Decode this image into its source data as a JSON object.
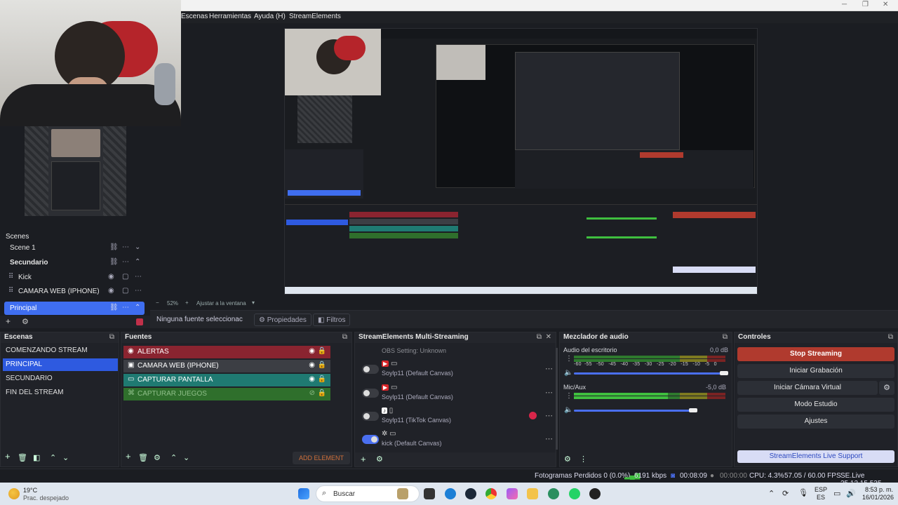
{
  "menu": [
    "Escenas",
    "Herramientas",
    "Ayuda (H)",
    "StreamElements"
  ],
  "left_scenes": {
    "header": "Scenes",
    "items": [
      {
        "label": "Scene 1"
      },
      {
        "label": "Secundario"
      },
      {
        "label": "Kick"
      },
      {
        "label": "CAMARA WEB (IPHONE)"
      },
      {
        "label": "Principal"
      }
    ]
  },
  "preview_bar": {
    "zoom": "52%",
    "fit": "Ajustar a la ventana"
  },
  "properties_bar": {
    "no_source": "Ninguna fuente seleccionac",
    "properties": "Propiedades",
    "filters": "Filtros"
  },
  "scenes_dock": {
    "title": "Escenas",
    "items": [
      "COMENZANDO STREAM",
      "PRINCIPAL",
      "SECUNDARIO",
      "FIN DEL STREAM"
    ],
    "selected": "PRINCIPAL"
  },
  "sources_dock": {
    "title": "Fuentes",
    "items": [
      {
        "label": "ALERTAS",
        "color": "#8a2430"
      },
      {
        "label": "CAMARA WEB (IPHONE)",
        "color": "#3c3e44"
      },
      {
        "label": "CAPTURAR PANTALLA",
        "color": "#1f7a72"
      },
      {
        "label": "CAPTURAR JUEGOS",
        "color": "#2f6f2c"
      }
    ],
    "add_element": "ADD ELEMENT"
  },
  "multistream_dock": {
    "title": "StreamElements Multi-Streaming",
    "obs_setting": "OBS Setting: Unknown",
    "rows": [
      {
        "label": "Soylp11 (Default Canvas)",
        "on": false,
        "icon": "youtube-icon"
      },
      {
        "label": "Soylp11 (Default Canvas)",
        "on": false,
        "icon": "youtube-icon"
      },
      {
        "label": "Soylp11 (TikTok Canvas)",
        "on": false,
        "icon": "tiktok-icon"
      },
      {
        "label": "kick (Default Canvas)",
        "on": true,
        "icon": "kick-icon"
      }
    ]
  },
  "mixer_dock": {
    "title": "Mezclador de audio",
    "channels": [
      {
        "name": "Audio del escritorio",
        "db": "0,0 dB",
        "level": 0
      },
      {
        "name": "Mic/Aux",
        "db": "-5,0 dB",
        "level": 0.62
      }
    ],
    "ticks": [
      "-60",
      "-55",
      "-50",
      "-45",
      "-40",
      "-35",
      "-30",
      "-25",
      "-20",
      "-15",
      "-10",
      "-5",
      "0"
    ]
  },
  "controls_dock": {
    "title": "Controles",
    "buttons": [
      "Stop Streaming",
      "Iniciar Grabación",
      "Iniciar Cámara Virtual",
      "Modo Estudio",
      "Ajustes"
    ],
    "support": "StreamElements Live Support"
  },
  "status": {
    "dropped": "Fotogramas Perdidos 0 (0.0%)",
    "bitrate": "6191 kbps",
    "live_time": "00:08:09",
    "rec_time": "00:00:00",
    "cpu": "CPU: 4.3%",
    "fps": "57.05 / 60.00 FPS",
    "version": "SE.Live 25.12.15.535"
  },
  "taskbar": {
    "temp": "19°C",
    "weather": "Prac. despejado",
    "search": "Buscar",
    "lang1": "ESP",
    "lang2": "ES",
    "time": "8:53 p. m.",
    "date": "16/01/2026"
  }
}
